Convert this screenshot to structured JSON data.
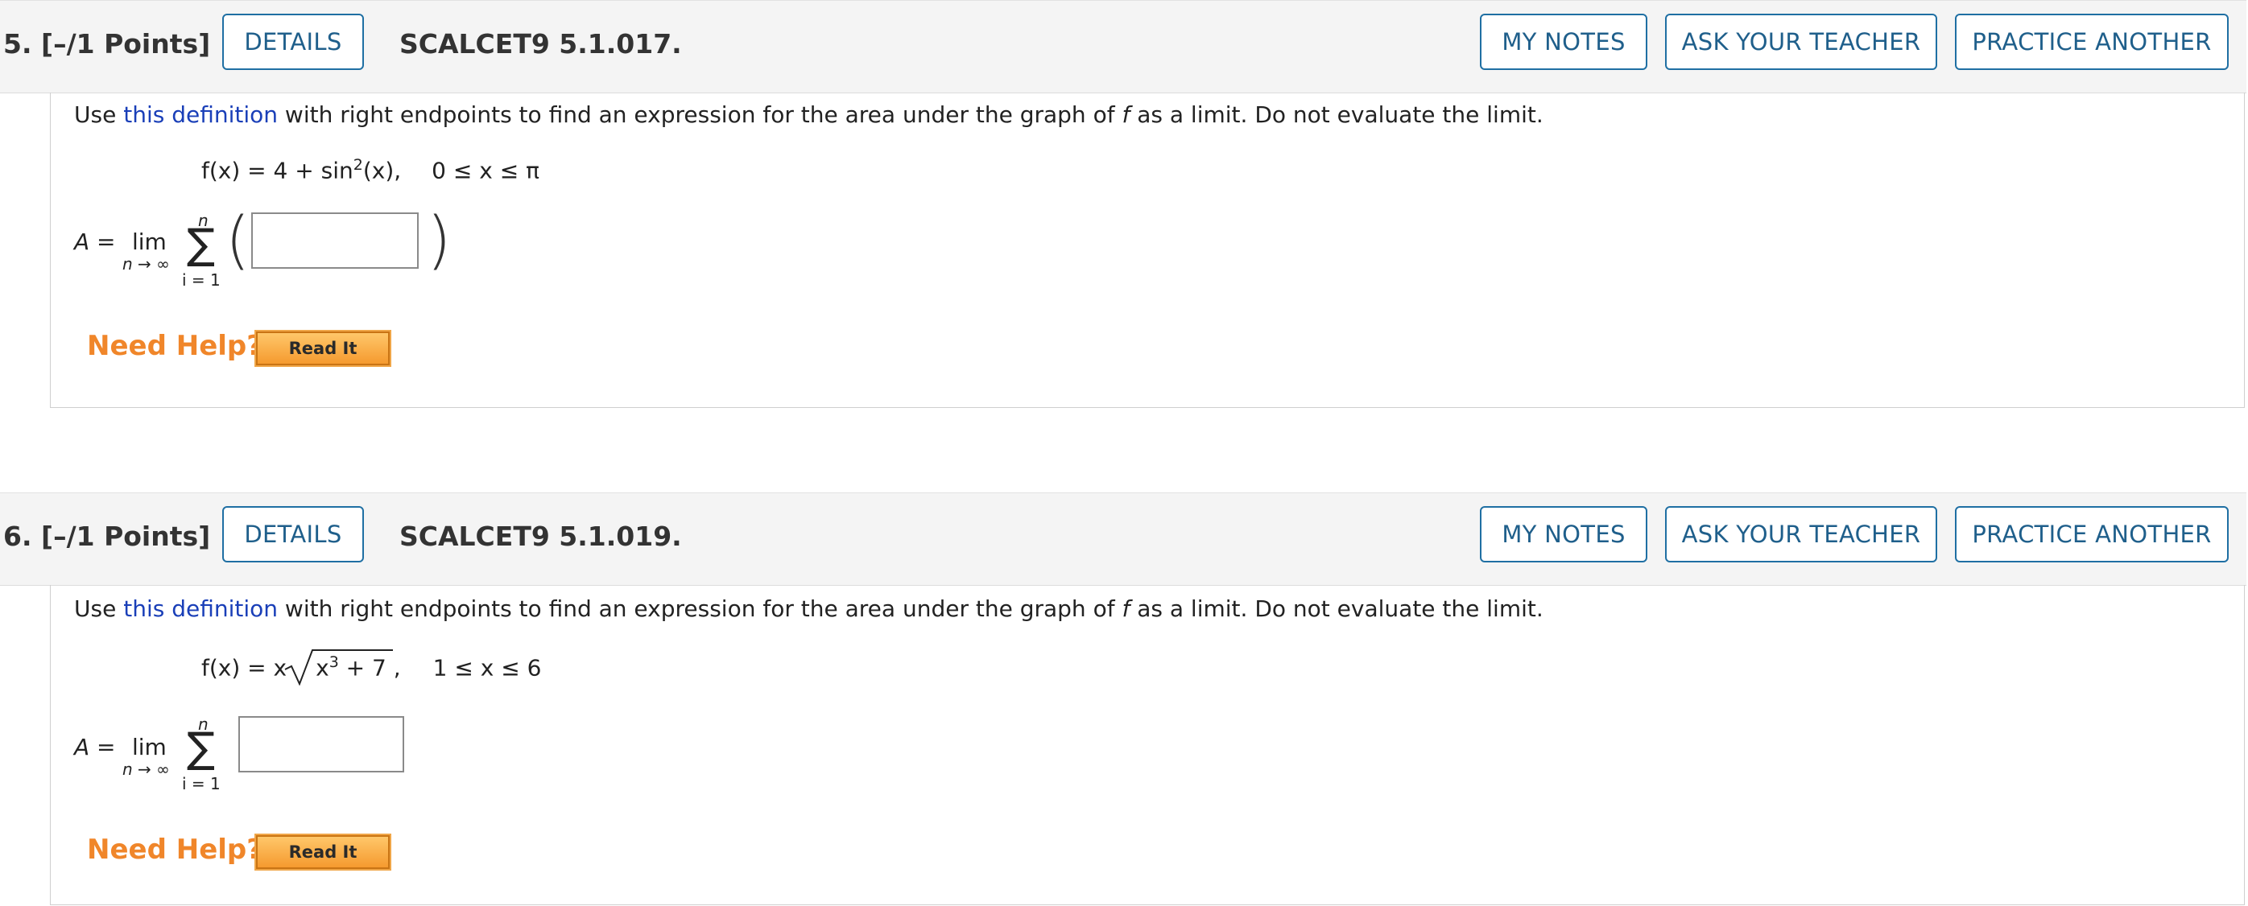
{
  "questions": [
    {
      "points": "5. [–/1 Points]",
      "details": "DETAILS",
      "code": "SCALCET9 5.1.017.",
      "my_notes": "MY NOTES",
      "ask_teacher": "ASK YOUR TEACHER",
      "practice": "PRACTICE ANOTHER",
      "prompt_pre": "Use ",
      "prompt_link": "this definition",
      "prompt_post": " with right endpoints to find an expression for the area under the graph of ",
      "prompt_f": "f",
      "prompt_end": " as a limit. Do not evaluate the limit.",
      "fx_lhs": "f(x) = 4 + sin",
      "fx_sup": "2",
      "fx_rhs": "(x),",
      "domain": "0 ≤ x ≤ π",
      "A_label": "A =",
      "lim": "lim",
      "lim_sub": "n → ∞",
      "sigma": "∑",
      "sum_top": "n",
      "sum_bottom": "i = 1",
      "answer": "",
      "need_help": "Need Help?",
      "read_it": "Read It"
    },
    {
      "points": "6. [–/1 Points]",
      "details": "DETAILS",
      "code": "SCALCET9 5.1.019.",
      "my_notes": "MY NOTES",
      "ask_teacher": "ASK YOUR TEACHER",
      "practice": "PRACTICE ANOTHER",
      "prompt_pre": "Use ",
      "prompt_link": "this definition",
      "prompt_post": " with right endpoints to find an expression for the area under the graph of ",
      "prompt_f": "f",
      "prompt_end": " as a limit. Do not evaluate the limit.",
      "fx_lhs": "f(x) = x",
      "fx_rad": "x",
      "fx_sup": "3",
      "fx_rad_rest": " + 7 ,",
      "domain": "1 ≤ x ≤ 6",
      "A_label": "A =",
      "lim": "lim",
      "lim_sub": "n → ∞",
      "sigma": "∑",
      "sum_top": "n",
      "sum_bottom": "i = 1",
      "answer": "",
      "need_help": "Need Help?",
      "read_it": "Read It"
    }
  ]
}
